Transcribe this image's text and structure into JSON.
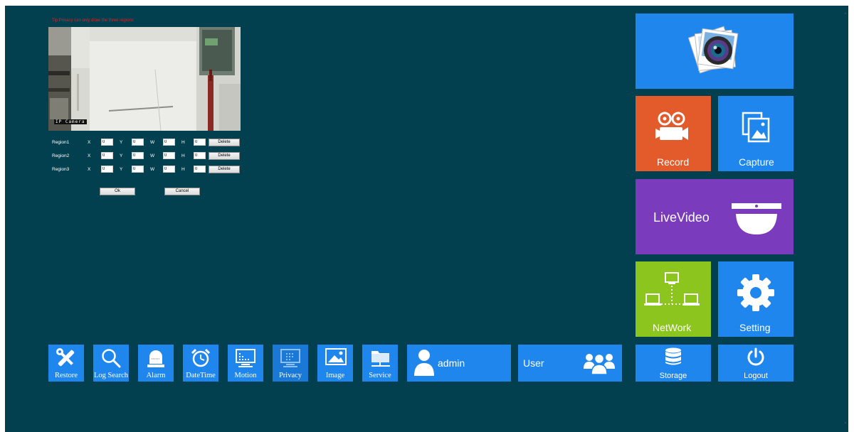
{
  "privacy": {
    "tip": "Tip:Privacy can only draw the three regions",
    "camera_label": "IP Camera",
    "regions": [
      {
        "name": "Region1",
        "x": "0",
        "y": "0",
        "w": "0",
        "h": "0",
        "delete_label": "Delete"
      },
      {
        "name": "Region2",
        "x": "0",
        "y": "0",
        "w": "0",
        "h": "0",
        "delete_label": "Delete"
      },
      {
        "name": "Region3",
        "x": "0",
        "y": "0",
        "w": "0",
        "h": "0",
        "delete_label": "Delete"
      }
    ],
    "field_labels": {
      "x": "X",
      "y": "Y",
      "w": "W",
      "h": "H"
    },
    "ok_label": "Ok",
    "cancel_label": "Cancel"
  },
  "tiles": {
    "gallery": {
      "icon": "photo-gallery-icon"
    },
    "record": {
      "label": "Record",
      "icon": "video-camera-icon"
    },
    "capture": {
      "label": "Capture",
      "icon": "pictures-icon"
    },
    "live_video": {
      "label": "LiveVideo",
      "icon": "dome-camera-icon"
    },
    "network": {
      "label": "NetWork",
      "icon": "network-icon"
    },
    "setting": {
      "label": "Setting",
      "icon": "gear-icon"
    },
    "storage": {
      "label": "Storage",
      "icon": "database-icon"
    },
    "logout": {
      "label": "Logout",
      "icon": "power-icon"
    }
  },
  "toolbar": {
    "items": [
      {
        "label": "Restore",
        "icon": "tools-icon"
      },
      {
        "label": "Log Search",
        "icon": "search-icon"
      },
      {
        "label": "Alarm",
        "icon": "alarm-icon"
      },
      {
        "label": "DateTime",
        "icon": "clock-icon"
      },
      {
        "label": "Motion",
        "icon": "motion-icon"
      },
      {
        "label": "Privacy",
        "icon": "privacy-icon"
      },
      {
        "label": "Image",
        "icon": "image-icon"
      },
      {
        "label": "Service",
        "icon": "folder-network-icon"
      }
    ],
    "admin_label": "admin",
    "user_label": "User"
  },
  "colors": {
    "background": "#03404f",
    "tile_blue": "#1f86ee",
    "tile_orange": "#e35a2b",
    "tile_purple": "#7a3cbd",
    "tile_green": "#8bc51d",
    "tip_red": "#e02020"
  }
}
